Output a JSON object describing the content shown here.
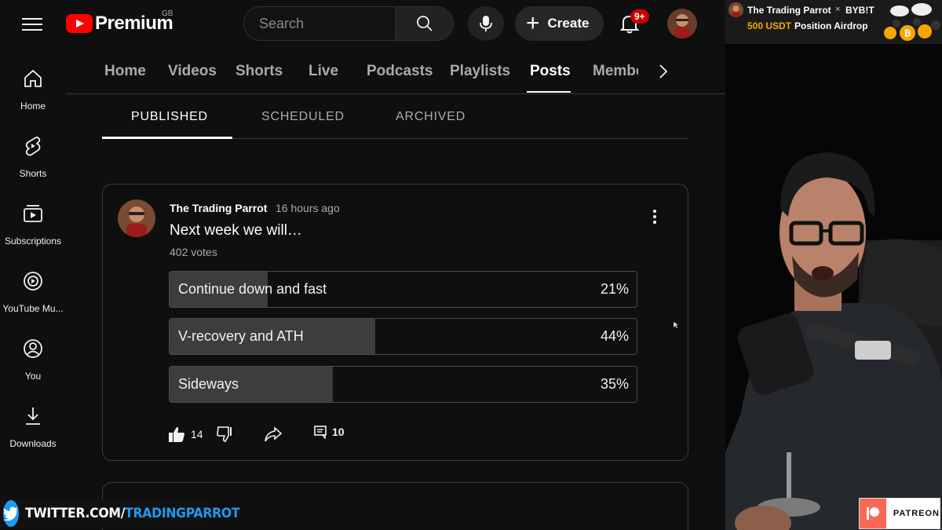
{
  "topbar": {
    "logo_text": "Premium",
    "region": "GB",
    "search_placeholder": "Search",
    "create_label": "Create",
    "notifications_badge": "9+"
  },
  "sidebar": {
    "items": [
      {
        "label": "Home",
        "icon": "home-icon"
      },
      {
        "label": "Shorts",
        "icon": "shorts-icon"
      },
      {
        "label": "Subscriptions",
        "icon": "subscriptions-icon"
      },
      {
        "label": "YouTube Mu...",
        "icon": "youtube-music-icon"
      },
      {
        "label": "You",
        "icon": "you-icon"
      },
      {
        "label": "Downloads",
        "icon": "downloads-icon"
      }
    ]
  },
  "channel_tabs": [
    {
      "label": "Home"
    },
    {
      "label": "Videos"
    },
    {
      "label": "Shorts"
    },
    {
      "label": "Live"
    },
    {
      "label": "Podcasts"
    },
    {
      "label": "Playlists"
    },
    {
      "label": "Posts",
      "active": true
    },
    {
      "label": "Membe"
    }
  ],
  "post_tabs": [
    {
      "label": "PUBLISHED",
      "active": true
    },
    {
      "label": "SCHEDULED"
    },
    {
      "label": "ARCHIVED"
    }
  ],
  "post": {
    "author": "The Trading Parrot",
    "time": "16 hours ago",
    "title": "Next week we will…",
    "votes": "402 votes",
    "options": [
      {
        "label": "Continue down and fast",
        "percent_label": "21%",
        "percent": 21
      },
      {
        "label": "V-recovery and ATH",
        "percent_label": "44%",
        "percent": 44
      },
      {
        "label": "Sideways",
        "percent_label": "35%",
        "percent": 35
      }
    ],
    "likes": "14",
    "comments": "10"
  },
  "ad": {
    "channel": "The Trading Parrot",
    "separator": "×",
    "brand": "BYB!T",
    "amount": "500 USDT",
    "offer": "Position Airdrop"
  },
  "overlay": {
    "twitter_prefix": "TWITTER.COM/",
    "twitter_handle": "TRADINGPARROT",
    "patreon": "PATREON"
  },
  "colors": {
    "background": "#0f0f0f",
    "youtube_red": "#ff0000",
    "badge_red": "#cc0000",
    "twitter_blue": "#1d9bf0",
    "patreon_coral": "#f96854",
    "bybit_gold": "#f7a600"
  }
}
